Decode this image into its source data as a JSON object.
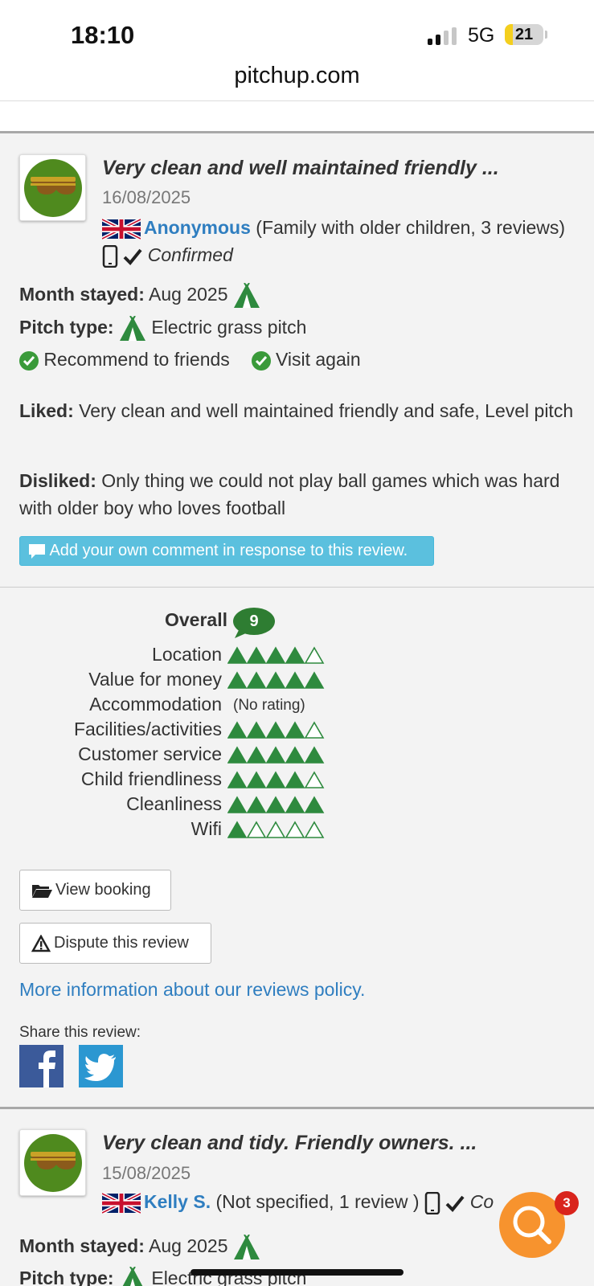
{
  "status": {
    "time": "18:10",
    "network": "5G",
    "battery": "21",
    "battery_level": 0.21
  },
  "browser": {
    "url": "pitchup.com"
  },
  "colors": {
    "accent_blue": "#2f7ec0",
    "tent_green": "#2e8a3e",
    "respond_btn": "#5bc0de",
    "fab_orange": "#f7932e"
  },
  "review1": {
    "avatar_icon": "bearded-goggles-avatar-icon",
    "title": "Very clean and well maintained friendly ...",
    "date": "16/08/2025",
    "reviewer": "Anonymous",
    "reviewer_meta": "(Family with older children, 3 reviews)",
    "confirmed": "Confirmed",
    "month_label": "Month stayed:",
    "month_value": "Aug 2025",
    "pitch_label": "Pitch type:",
    "pitch_value": "Electric grass pitch",
    "recommend": "Recommend to friends",
    "visit_again": "Visit again",
    "liked_label": "Liked:",
    "liked_text": "Very clean and well maintained friendly and safe, Level pitch",
    "disliked_label": "Disliked:",
    "disliked_text": "Only thing we could not play ball games which was hard with older boy who loves football",
    "respond_button": "Add your own comment in response to this review.",
    "overall_label": "Overall",
    "overall_score": "9",
    "ratings": [
      {
        "label": "Location",
        "stars": 4
      },
      {
        "label": "Value for money",
        "stars": 5
      },
      {
        "label": "Accommodation",
        "stars": null,
        "text": "(No rating)"
      },
      {
        "label": "Facilities/activities",
        "stars": 4
      },
      {
        "label": "Customer service",
        "stars": 5
      },
      {
        "label": "Child friendliness",
        "stars": 4
      },
      {
        "label": "Cleanliness",
        "stars": 5
      },
      {
        "label": "Wifi",
        "stars": 1
      }
    ],
    "view_booking": "View booking",
    "dispute": "Dispute this review",
    "policy_link": "More information about our reviews policy.",
    "share_label": "Share this review:"
  },
  "review2": {
    "title": "Very clean and tidy. Friendly owners. ...",
    "date": "15/08/2025",
    "reviewer": "Kelly S.",
    "reviewer_meta": "(Not specified, 1 review )",
    "confirmed": "Co",
    "month_label": "Month stayed:",
    "month_value": "Aug 2025",
    "pitch_label": "Pitch type:",
    "pitch_value": "Electric grass pitch"
  },
  "fab": {
    "badge": "3"
  }
}
